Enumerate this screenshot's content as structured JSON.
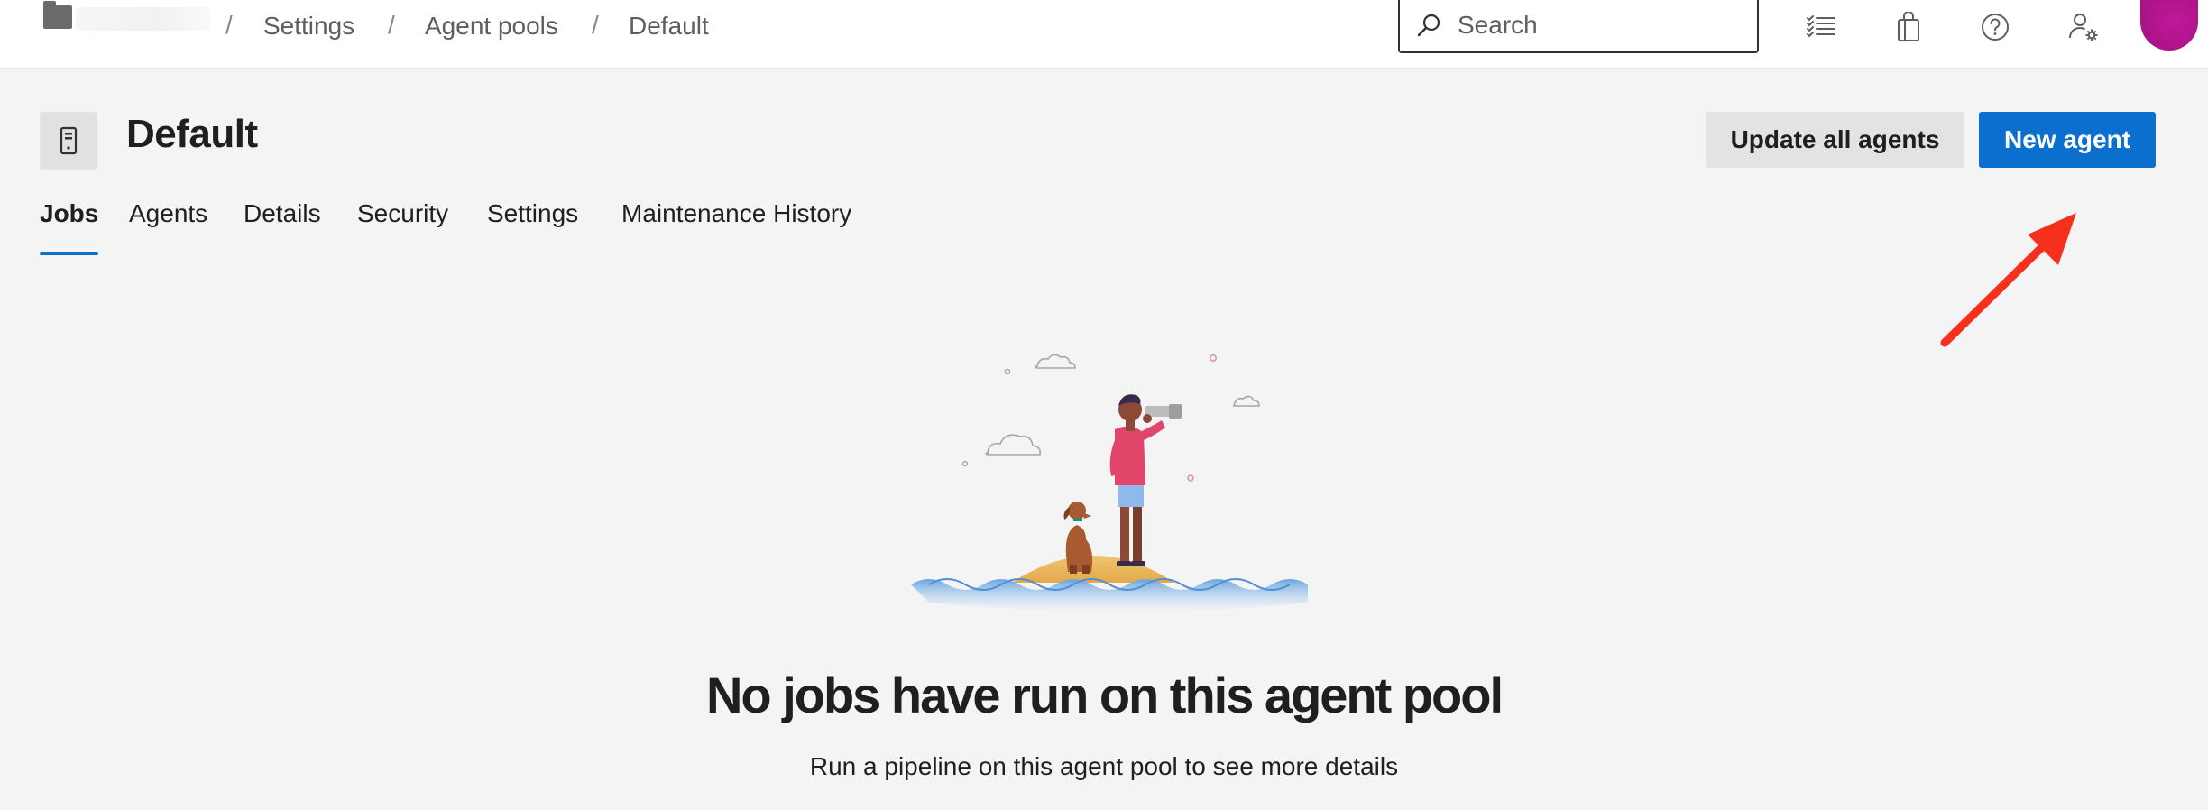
{
  "breadcrumb": {
    "items": [
      {
        "label": "Settings"
      },
      {
        "label": "Agent pools"
      },
      {
        "label": "Default"
      }
    ],
    "separator": "/"
  },
  "search": {
    "placeholder": "Search",
    "value": ""
  },
  "topbar_icons": [
    "work-items-list-icon",
    "marketplace-bag-icon",
    "help-icon",
    "user-settings-icon"
  ],
  "avatar_color": "#b0148c",
  "header": {
    "title": "Default",
    "icon": "agent-pool-icon"
  },
  "actions": {
    "update_all_label": "Update all agents",
    "new_agent_label": "New agent"
  },
  "tabs": [
    {
      "label": "Jobs",
      "active": true
    },
    {
      "label": "Agents",
      "active": false
    },
    {
      "label": "Details",
      "active": false
    },
    {
      "label": "Security",
      "active": false
    },
    {
      "label": "Settings",
      "active": false
    },
    {
      "label": "Maintenance History",
      "active": false
    }
  ],
  "empty_state": {
    "title": "No jobs have run on this agent pool",
    "subtitle": "Run a pipeline on this agent pool to see more details",
    "illustration": "person-with-telescope-and-dog-on-island"
  },
  "colors": {
    "accent": "#0b6fd0",
    "annotation_arrow": "#f5301c"
  }
}
